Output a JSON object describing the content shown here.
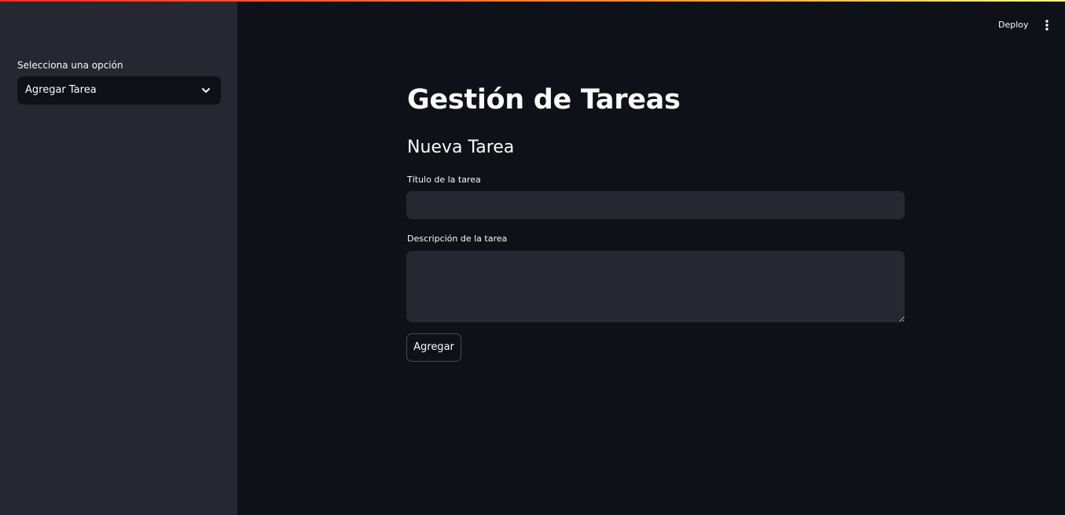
{
  "sidebar": {
    "select_label": "Selecciona una opción",
    "select_value": "Agregar Tarea"
  },
  "header": {
    "deploy_label": "Deploy",
    "menu_icon": "vertical-ellipsis-icon"
  },
  "main": {
    "title": "Gestión de Tareas",
    "section_title": "Nueva Tarea",
    "title_field": {
      "label": "Título de la tarea",
      "value": ""
    },
    "description_field": {
      "label": "Descripción de la tarea",
      "value": ""
    },
    "submit_label": "Agregar"
  },
  "colors": {
    "background": "#0e1117",
    "sidebar_background": "#262730",
    "input_background": "#262730",
    "text": "#fafafa",
    "accent_gradient_start": "#ff2b2b",
    "accent_gradient_end": "#fffd80"
  }
}
